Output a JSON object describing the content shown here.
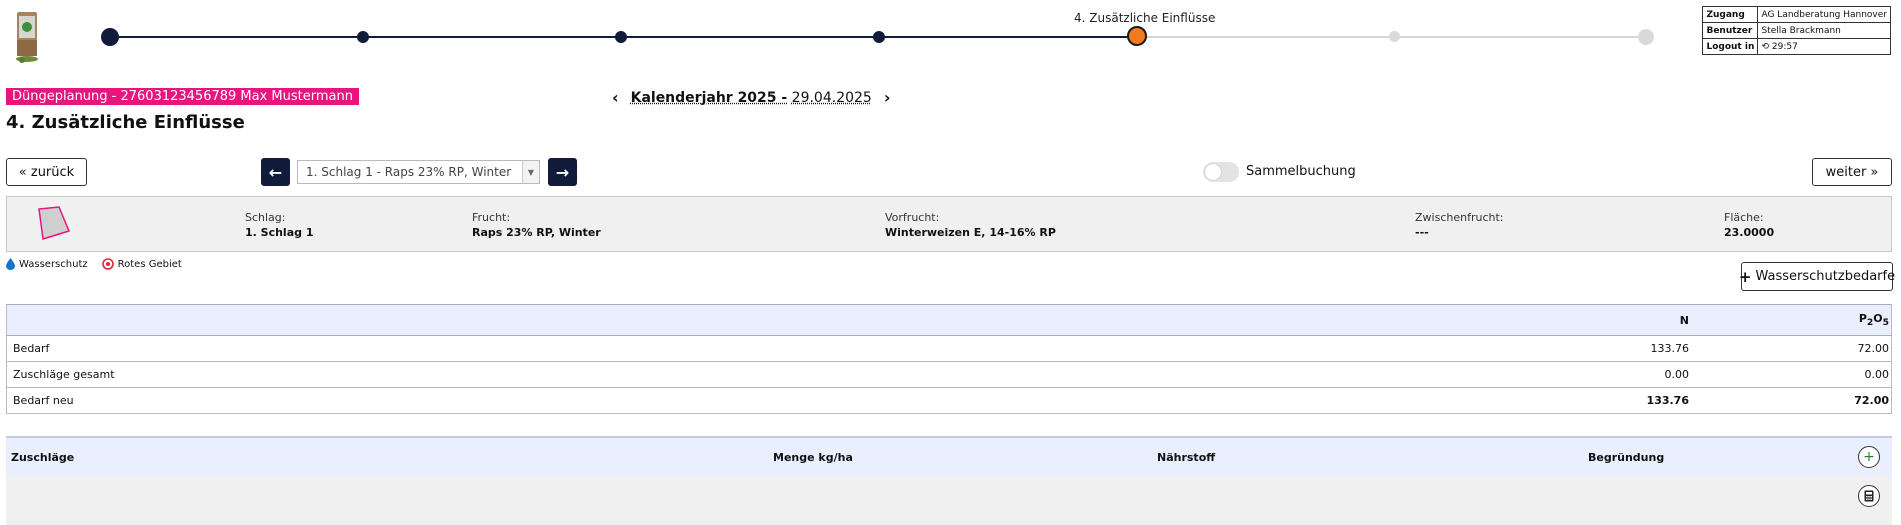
{
  "stepper": {
    "active_label": "4. Zusätzliche Einflüsse"
  },
  "session": {
    "rows": [
      {
        "key": "Zugang",
        "value": "AG Landberatung Hannover"
      },
      {
        "key": "Benutzer",
        "value": "Stella Brackmann"
      },
      {
        "key": "Logout in",
        "value": "29:57"
      }
    ]
  },
  "header": {
    "planning_tag": "Düngeplanung - 27603123456789 Max Mustermann",
    "year_label": "Kalenderjahr 2025 -",
    "date": "29.04.2025",
    "page_title": "4. Zusätzliche Einflüsse"
  },
  "toolbar": {
    "back_label": "« zurück",
    "next_label": "weiter »",
    "field_select_value": "1. Schlag 1 - Raps 23% RP, Winter",
    "toggle_label": "Sammelbuchung"
  },
  "info": {
    "schlag": {
      "label": "Schlag:",
      "value": "1. Schlag 1"
    },
    "frucht": {
      "label": "Frucht:",
      "value": "Raps 23% RP, Winter"
    },
    "vorfrucht": {
      "label": "Vorfrucht:",
      "value": "Winterweizen E, 14-16% RP"
    },
    "zwischenfrucht": {
      "label": "Zwischenfrucht:",
      "value": "---"
    },
    "flaeche": {
      "label": "Fläche:",
      "value": "23.0000"
    }
  },
  "legend": {
    "wasserschutz": "Wasserschutz",
    "rotes_gebiet": "Rotes Gebiet"
  },
  "water_button_label": "Wasserschutzbedarfe",
  "requirements": {
    "col_n": "N",
    "col_p_main": "P",
    "col_p_sub1": "2",
    "col_p_mid": "O",
    "col_p_sub2": "5",
    "rows": [
      {
        "name": "Bedarf",
        "n": "133.76",
        "p": "72.00"
      },
      {
        "name": "Zuschläge gesamt",
        "n": "0.00",
        "p": "0.00"
      },
      {
        "name": "Bedarf neu",
        "n": "133.76",
        "p": "72.00"
      }
    ]
  },
  "additions": {
    "col_zuschlaege": "Zuschläge",
    "col_menge": "Menge kg/ha",
    "col_naehrstoff": "Nährstoff",
    "col_begruendung": "Begründung"
  },
  "colors": {
    "accent_navy": "#111c3a",
    "active_step": "#f47a1f",
    "tag_pink": "#e8157f",
    "header_blue": "#e9efff"
  }
}
